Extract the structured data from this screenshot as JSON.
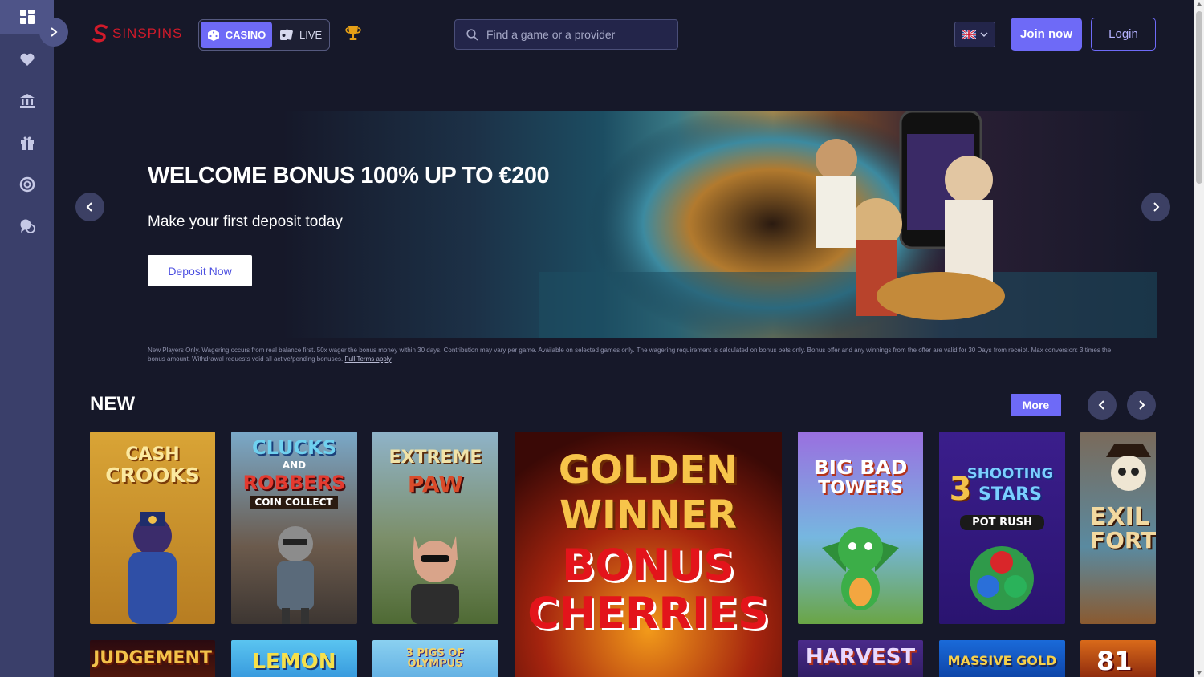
{
  "sidebar": {
    "items": [
      {
        "name": "dashboard-icon"
      },
      {
        "name": "heart-icon"
      },
      {
        "name": "bank-icon"
      },
      {
        "name": "gift-icon"
      },
      {
        "name": "lifebuoy-icon"
      },
      {
        "name": "chat-help-icon"
      }
    ]
  },
  "header": {
    "logo_text": "SINSPINS",
    "mode_casino": "CASINO",
    "mode_live": "LIVE",
    "search_placeholder": "Find a game or a provider",
    "join_label": "Join now",
    "login_label": "Login"
  },
  "banner": {
    "title": "WELCOME BONUS 100% UP TO €200",
    "subtitle": "Make your first deposit today",
    "cta": "Deposit Now",
    "terms_line1": "New Players Only. Wagering occurs from real balance first. 50x wager the bonus money within 30 days. Contribution may vary per game. Available on selected games only. The wagering requirement is calculated on bonus bets only. Bonus offer and any winnings from the offer are",
    "terms_line2": "valid for 30 Days from receipt. Max conversion: 3 times the bonus amount. Withdrawal requests void all active/pending bonuses.",
    "terms_link": "Full Terms apply"
  },
  "section_new": {
    "title": "NEW",
    "more": "More",
    "games_row1": [
      {
        "line1": "CASH",
        "line2": "CROOKS"
      },
      {
        "line1": "CLUCKS",
        "line2": "AND",
        "line3": "ROBBERS",
        "line4": "COIN COLLECT"
      },
      {
        "line1": "EXTREME",
        "line2": "PAW"
      },
      {
        "line1": "GOLDEN",
        "line2": "WINNER",
        "line3": "BONUS",
        "line4": "CHERRIES"
      },
      {
        "line1": "BIG BAD",
        "line2": "TOWERS"
      },
      {
        "line1": "3",
        "line2": "SHOOTING",
        "line3": "STARS",
        "line4": "POT RUSH"
      },
      {
        "line1": "EXIL",
        "line2": "FORTU"
      }
    ],
    "games_row2": [
      {
        "label": "JUDGEMENT"
      },
      {
        "label": "LEMON"
      },
      {
        "label": "3 PIGS OF OLYMPUS"
      },
      {
        "label": "HARVEST"
      },
      {
        "label": "MASSIVE GOLD"
      },
      {
        "label": "81"
      }
    ]
  },
  "colors": {
    "accent": "#6e6af7",
    "brand_red": "#d11a2a",
    "background": "#161829",
    "sidebar": "#3a3f6a"
  }
}
